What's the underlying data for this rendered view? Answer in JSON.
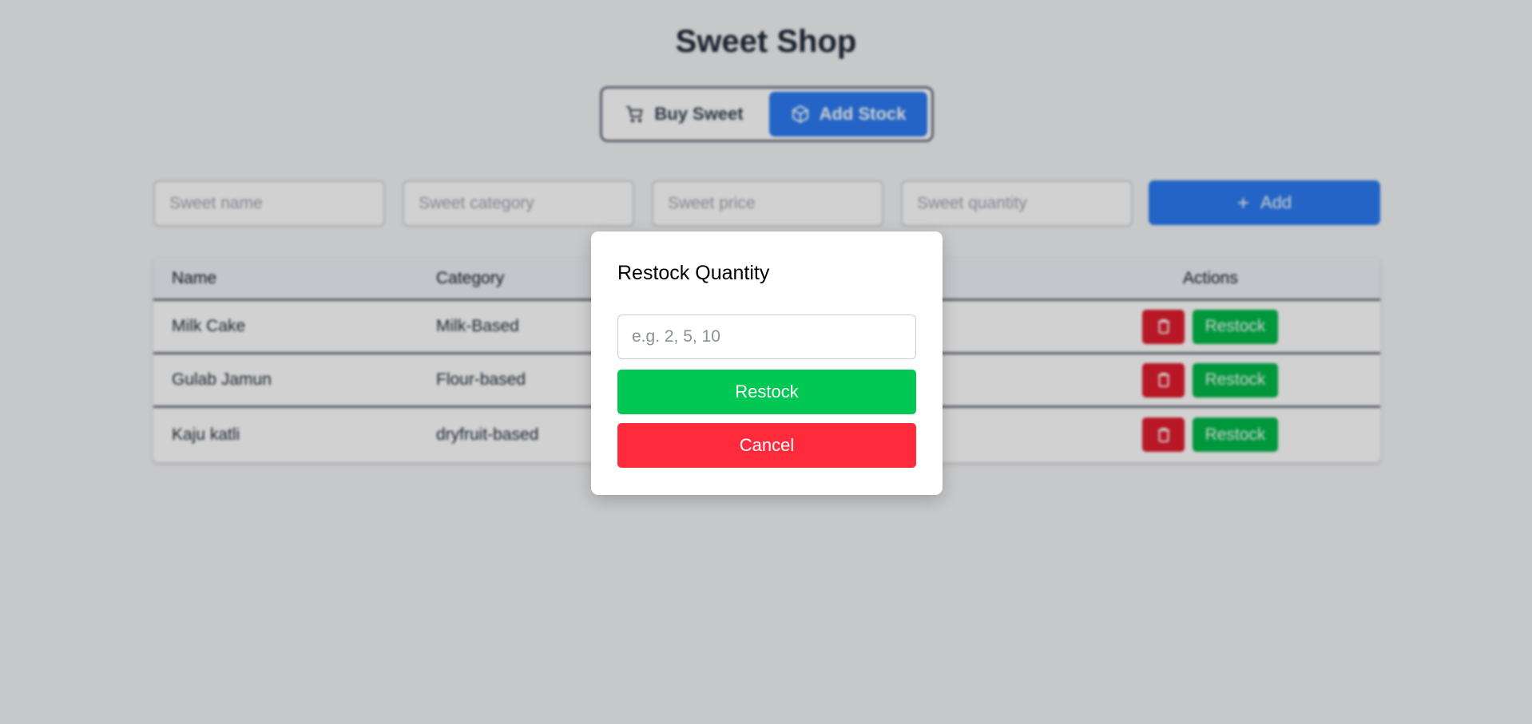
{
  "app": {
    "title": "Sweet Shop"
  },
  "mode_toggle": {
    "buy_label": "Buy Sweet",
    "add_label": "Add Stock",
    "active": "Add Stock"
  },
  "add_form": {
    "name_placeholder": "Sweet name",
    "category_placeholder": "Sweet category",
    "price_placeholder": "Sweet price",
    "quantity_placeholder": "Sweet quantity",
    "add_label": "Add"
  },
  "table": {
    "headers": {
      "name": "Name",
      "category": "Category",
      "actions": "Actions"
    },
    "rows": [
      {
        "name": "Milk Cake",
        "category": "Milk-Based",
        "restock_label": "Restock"
      },
      {
        "name": "Gulab Jamun",
        "category": "Flour-based",
        "restock_label": "Restock"
      },
      {
        "name": "Kaju katli",
        "category": "dryfruit-based",
        "restock_label": "Restock"
      }
    ]
  },
  "restock_modal": {
    "title": "Restock Quantity",
    "input_placeholder": "e.g. 2, 5, 10",
    "restock_label": "Restock",
    "cancel_label": "Cancel"
  },
  "colors": {
    "primary_blue": "#2b7bf2",
    "success_green": "#00c853",
    "danger_red": "#ff2b3c"
  }
}
